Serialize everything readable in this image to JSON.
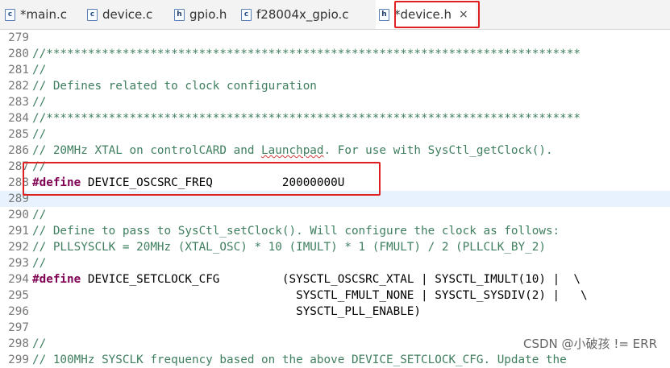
{
  "tabs": [
    {
      "label": "*main.c",
      "file_type": "c",
      "active": false
    },
    {
      "label": "device.c",
      "file_type": "c",
      "active": false
    },
    {
      "label": "gpio.h",
      "file_type": "h",
      "active": false
    },
    {
      "label": "f28004x_gpio.c",
      "file_type": "c",
      "active": false
    },
    {
      "label": "*device.h",
      "file_type": "h",
      "active": true,
      "close_glyph": "×"
    }
  ],
  "editor": {
    "lines": [
      {
        "n": "279",
        "tokens": []
      },
      {
        "n": "280",
        "tokens": [
          {
            "t": "//*****************************************************************************",
            "c": "cm"
          }
        ]
      },
      {
        "n": "281",
        "tokens": [
          {
            "t": "//",
            "c": "cm"
          }
        ]
      },
      {
        "n": "282",
        "tokens": [
          {
            "t": "// Defines related to clock configuration",
            "c": "cm"
          }
        ]
      },
      {
        "n": "283",
        "tokens": [
          {
            "t": "//",
            "c": "cm"
          }
        ]
      },
      {
        "n": "284",
        "tokens": [
          {
            "t": "//*****************************************************************************",
            "c": "cm"
          }
        ]
      },
      {
        "n": "285",
        "tokens": [
          {
            "t": "//",
            "c": "cm"
          }
        ]
      },
      {
        "n": "286",
        "tokens": [
          {
            "t": "// 20MHz XTAL on controlCARD and ",
            "c": "cm"
          },
          {
            "t": "Launchpad",
            "c": "cm squig"
          },
          {
            "t": ". For use with SysCtl_getClock().",
            "c": "cm"
          }
        ]
      },
      {
        "n": "287",
        "tokens": [
          {
            "t": "//",
            "c": "cm"
          }
        ]
      },
      {
        "n": "288",
        "tokens": [
          {
            "t": "#define",
            "c": "kw"
          },
          {
            "t": " DEVICE_OSCSRC_FREQ          20000000U",
            "c": "id"
          }
        ]
      },
      {
        "n": "289",
        "tokens": [],
        "current": true
      },
      {
        "n": "290",
        "tokens": [
          {
            "t": "//",
            "c": "cm"
          }
        ]
      },
      {
        "n": "291",
        "tokens": [
          {
            "t": "// Define to pass to SysCtl_setClock(). Will configure the clock as follows:",
            "c": "cm"
          }
        ]
      },
      {
        "n": "292",
        "tokens": [
          {
            "t": "// PLLSYSCLK = 20MHz (XTAL_OSC) * 10 (IMULT) * 1 (FMULT) / 2 (PLLCLK_BY_2)",
            "c": "cm"
          }
        ]
      },
      {
        "n": "293",
        "tokens": [
          {
            "t": "//",
            "c": "cm"
          }
        ]
      },
      {
        "n": "294",
        "tokens": [
          {
            "t": "#define",
            "c": "kw"
          },
          {
            "t": " DEVICE_SETCLOCK_CFG         (SYSCTL_OSCSRC_XTAL | SYSCTL_IMULT(10) |  \\",
            "c": "id"
          }
        ]
      },
      {
        "n": "295",
        "tokens": [
          {
            "t": "                                      SYSCTL_FMULT_NONE | SYSCTL_SYSDIV(2) |   \\",
            "c": "id"
          }
        ]
      },
      {
        "n": "296",
        "tokens": [
          {
            "t": "                                      SYSCTL_PLL_ENABLE)",
            "c": "id"
          }
        ]
      },
      {
        "n": "297",
        "tokens": []
      },
      {
        "n": "298",
        "tokens": [
          {
            "t": "//",
            "c": "cm"
          }
        ]
      },
      {
        "n": "299",
        "tokens": [
          {
            "t": "// 100MHz SYSCLK frequency based on the above DEVICE_SETCLOCK_CFG. Update the",
            "c": "cm"
          }
        ]
      }
    ]
  },
  "watermark": "CSDN @小破孩 != ERR",
  "colors": {
    "comment": "#3f7f5f",
    "keyword": "#7f0055",
    "current_line": "#e8f2fe",
    "annotation_box": "#e02020"
  }
}
